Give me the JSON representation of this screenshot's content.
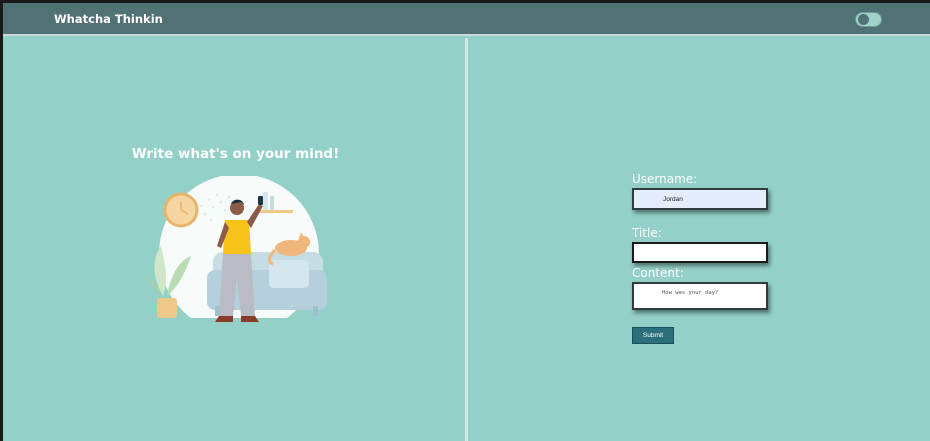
{
  "header": {
    "brand": "Whatcha Thinkin",
    "theme_toggle": {
      "state": "off"
    }
  },
  "left": {
    "headline": "Write what's on your mind!",
    "illustration": "person-on-phone-with-cat-on-sofa"
  },
  "form": {
    "username_label": "Username:",
    "username_value": "Jordan",
    "title_label": "Title:",
    "title_value": "",
    "content_label": "Content:",
    "content_placeholder": "How was your day?",
    "submit_label": "Submit"
  },
  "colors": {
    "header_bg": "#507275",
    "page_bg": "#93d0c7",
    "button_bg": "#2b6f7a"
  }
}
